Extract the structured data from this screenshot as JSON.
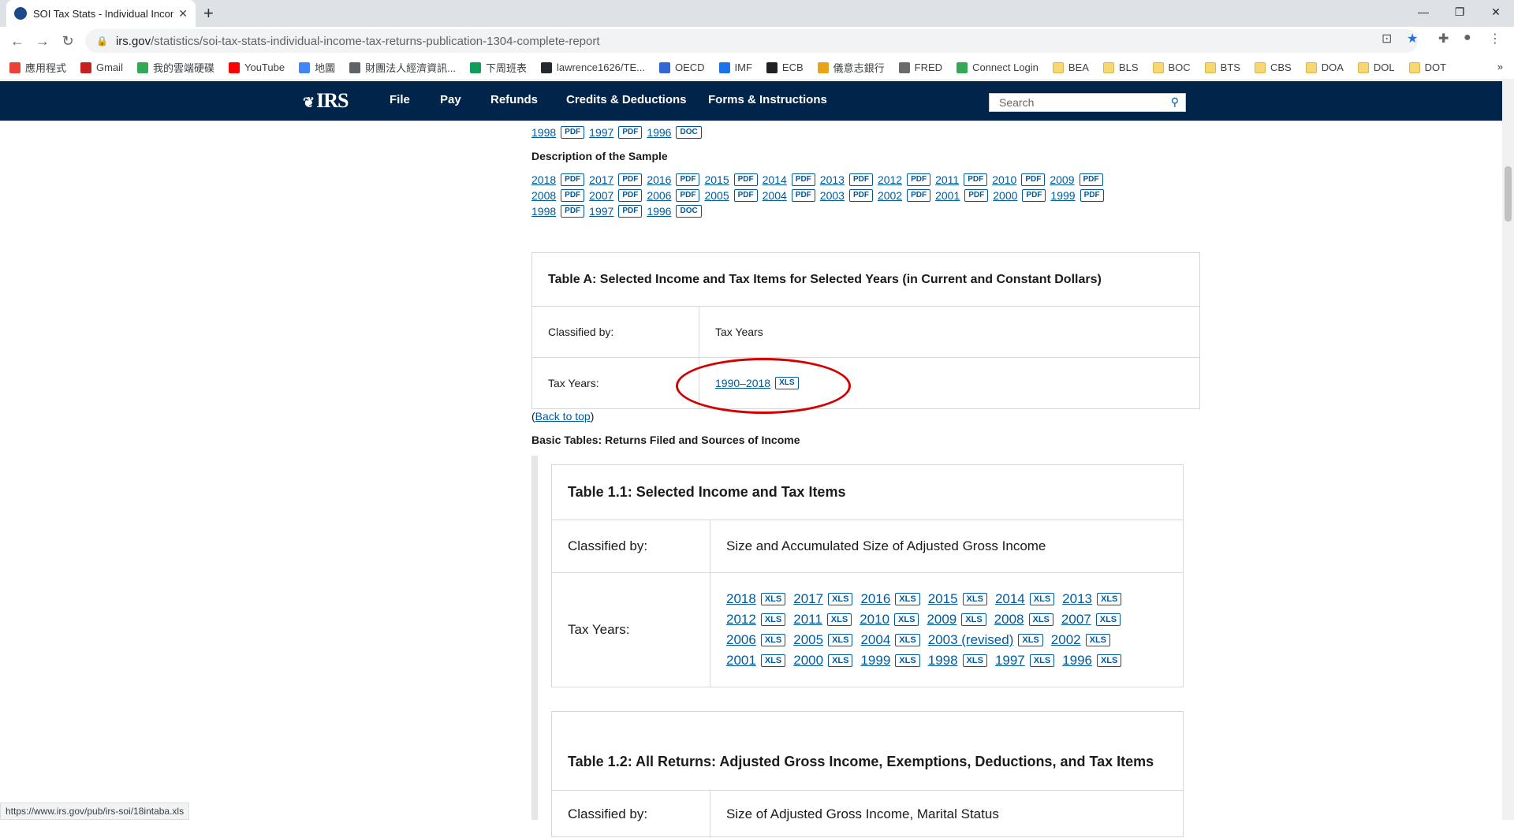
{
  "browser": {
    "tab_title": "SOI Tax Stats - Individual Incon",
    "url_host": "irs.gov",
    "url_path": "/statistics/soi-tax-stats-individual-income-tax-returns-publication-1304-complete-report",
    "status_url": "https://www.irs.gov/pub/irs-soi/18intaba.xls",
    "bookmarks": [
      "應用程式",
      "Gmail",
      "我的雲端硬碟",
      "YouTube",
      "地圖",
      "財團法人經濟資訊...",
      "下周班表",
      "lawrence1626/TE...",
      "OECD",
      "IMF",
      "ECB",
      "儀意志銀行",
      "FRED",
      "Connect Login",
      "BEA",
      "BLS",
      "BOC",
      "BTS",
      "CBS",
      "DOA",
      "DOL",
      "DOT"
    ],
    "bookmarks_more": "»"
  },
  "irs": {
    "logo": "IRS",
    "nav": [
      "File",
      "Pay",
      "Refunds",
      "Credits & Deductions",
      "Forms & Instructions"
    ],
    "search_placeholder": "Search"
  },
  "top_partial": {
    "line_years": [
      "1998",
      "1997",
      "1996"
    ],
    "line_badges": [
      "PDF",
      "PDF",
      "DOC"
    ]
  },
  "description_sample": {
    "title": "Description of the Sample",
    "rows": [
      [
        [
          "2018",
          "PDF"
        ],
        [
          "2017",
          "PDF"
        ],
        [
          "2016",
          "PDF"
        ],
        [
          "2015",
          "PDF"
        ],
        [
          "2014",
          "PDF"
        ],
        [
          "2013",
          "PDF"
        ],
        [
          "2012",
          "PDF"
        ],
        [
          "2011",
          "PDF"
        ],
        [
          "2010",
          "PDF"
        ],
        [
          "2009",
          "PDF"
        ]
      ],
      [
        [
          "2008",
          "PDF"
        ],
        [
          "2007",
          "PDF"
        ],
        [
          "2006",
          "PDF"
        ],
        [
          "2005",
          "PDF"
        ],
        [
          "2004",
          "PDF"
        ],
        [
          "2003",
          "PDF"
        ],
        [
          "2002",
          "PDF"
        ],
        [
          "2001",
          "PDF"
        ],
        [
          "2000",
          "PDF"
        ],
        [
          "1999",
          "PDF"
        ]
      ],
      [
        [
          "1998",
          "PDF"
        ],
        [
          "1997",
          "PDF"
        ],
        [
          "1996",
          "DOC"
        ]
      ]
    ]
  },
  "table_a": {
    "caption": "Table A: Selected Income and Tax Items for Selected Years (in Current and Constant Dollars)",
    "classified_label": "Classified by:",
    "classified_value": "Tax Years",
    "years_label": "Tax Years:",
    "year_link": "1990–2018",
    "year_badge": "XLS"
  },
  "back_to_top": "Back to top",
  "paren_open": "(",
  "paren_close": ")",
  "basic_tables_title": "Basic Tables: Returns Filed and Sources of Income",
  "table_1_1": {
    "caption": "Table 1.1: Selected Income and Tax Items",
    "classified_label": "Classified by:",
    "classified_value": "Size and Accumulated Size of Adjusted Gross Income",
    "years_label": "Tax Years:",
    "years": [
      "2018",
      "2017",
      "2016",
      "2015",
      "2014",
      "2013",
      "2012",
      "2011",
      "2010",
      "2009",
      "2008",
      "2007",
      "2006",
      "2005",
      "2004",
      "2003 (revised)",
      "2002",
      "2001",
      "2000",
      "1999",
      "1998",
      "1997",
      "1996"
    ],
    "badge": "XLS"
  },
  "table_1_2": {
    "caption": "Table 1.2: All Returns: Adjusted Gross Income, Exemptions, Deductions, and Tax Items",
    "classified_label": "Classified by:",
    "classified_value": "Size of Adjusted Gross Income, Marital Status"
  }
}
